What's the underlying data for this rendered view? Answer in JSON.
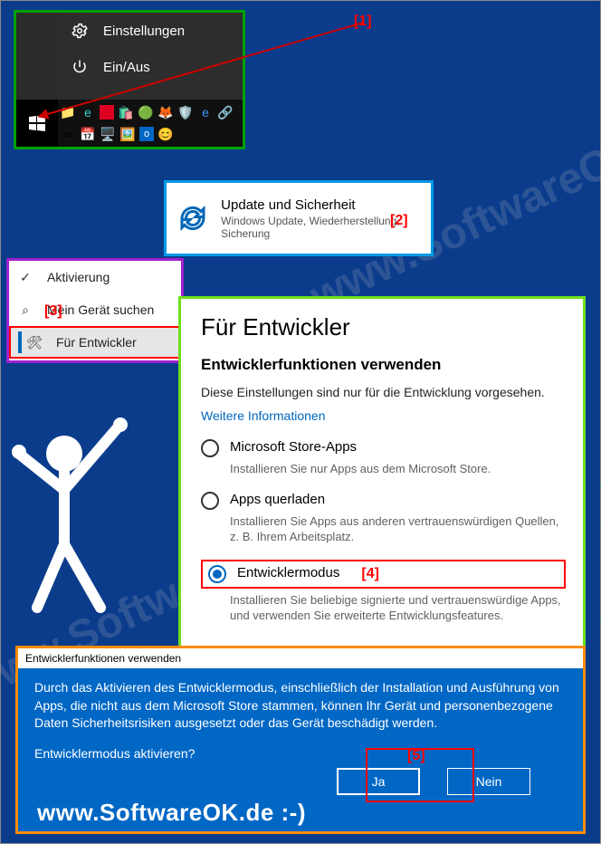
{
  "watermark": "www.SoftwareOK.de :-)",
  "callouts": {
    "n1": "[1]",
    "n2": "[2]",
    "n3": "[3]",
    "n4": "[4]",
    "n5": "[5]"
  },
  "start": {
    "settings": "Einstellungen",
    "power": "Ein/Aus"
  },
  "tile": {
    "title": "Update und Sicherheit",
    "sub": "Windows Update, Wiederherstellung, Sicherung"
  },
  "sidebar": {
    "activation": "Aktivierung",
    "find": "Mein Gerät suchen",
    "dev": "Für Entwickler"
  },
  "dev": {
    "heading": "Für Entwickler",
    "subheading": "Entwicklerfunktionen verwenden",
    "intro": "Diese Einstellungen sind nur für die Entwicklung vorgesehen.",
    "link": "Weitere Informationen",
    "opt1_label": "Microsoft Store-Apps",
    "opt1_desc": "Installieren Sie nur Apps aus dem Microsoft Store.",
    "opt2_label": "Apps querladen",
    "opt2_desc": "Installieren Sie Apps aus anderen vertrauenswürdigen Quellen, z. B. Ihrem Arbeitsplatz.",
    "opt3_label": "Entwicklermodus",
    "opt3_desc": "Installieren Sie beliebige signierte und vertrauenswürdige Apps, und verwenden Sie erweiterte Entwicklungsfeatures."
  },
  "dialog": {
    "title": "Entwicklerfunktionen verwenden",
    "body": "Durch das Aktivieren des Entwicklermodus, einschließlich der Installation und Ausführung von Apps, die nicht aus dem Microsoft Store stammen, können Ihr Gerät und personenbezogene Daten Sicherheitsrisiken ausgesetzt oder das Gerät beschädigt werden.",
    "question": "Entwicklermodus aktivieren?",
    "yes": "Ja",
    "no": "Nein"
  }
}
